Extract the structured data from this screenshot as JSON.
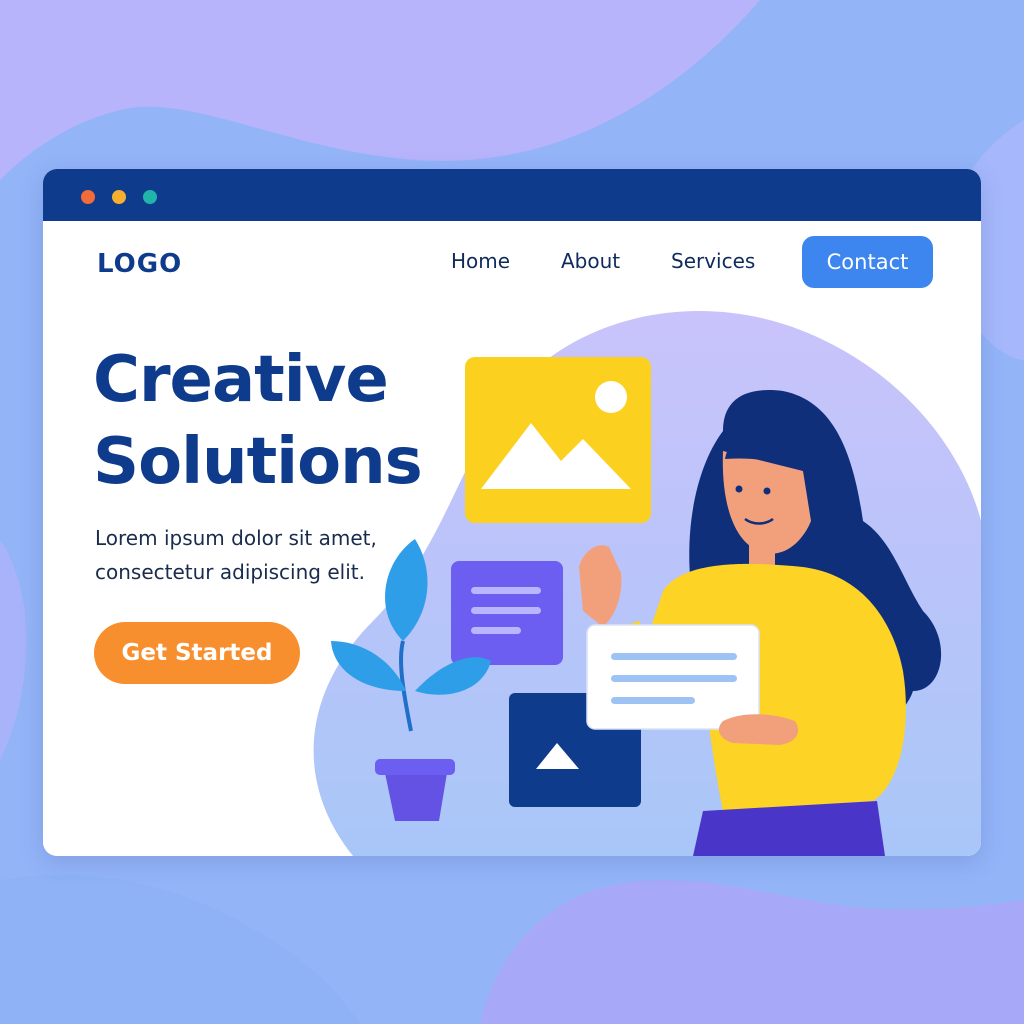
{
  "colors": {
    "page_background": "#9ab8f8",
    "titlebar": "#0f3b8c",
    "brand_text": "#0f3b8c",
    "contact_button": "#3d86f0",
    "cta_button": "#f78f2e",
    "accent_yellow": "#fcd01f",
    "accent_purple": "#6b5ef0"
  },
  "window": {
    "controls": [
      "close-dot",
      "minimize-dot",
      "maximize-dot"
    ]
  },
  "header": {
    "logo": "LOGO",
    "nav": {
      "home": "Home",
      "about": "About",
      "services": "Services",
      "contact": "Contact"
    }
  },
  "hero": {
    "title_line1": "Creative",
    "title_line2": "Solutions",
    "subtitle_line1": "Lorem ipsum dolor sit amet,",
    "subtitle_line2": "consectetur adipiscing elit.",
    "cta": "Get Started"
  },
  "illustration": {
    "icons": [
      "image-card-icon",
      "text-card-icon",
      "dialog-card-icon",
      "photo-card-icon",
      "plant-icon",
      "woman-figure"
    ]
  }
}
